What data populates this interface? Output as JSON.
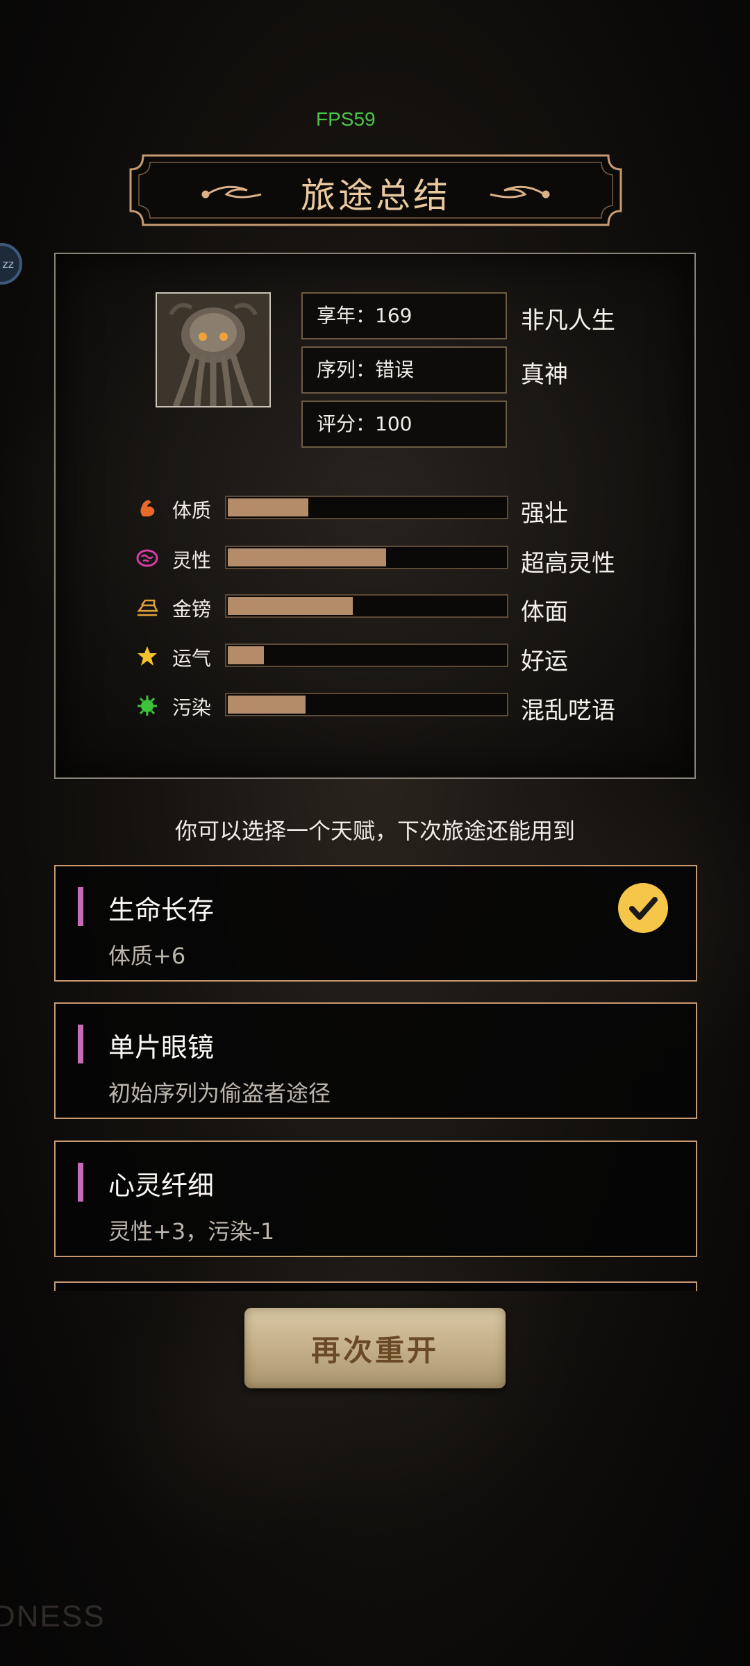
{
  "fps": "FPS59",
  "side_bubble": "zz",
  "banner": {
    "title": "旅途总结"
  },
  "summary": {
    "info": [
      {
        "label": "享年：169",
        "right": "非凡人生"
      },
      {
        "label": "序列：错误",
        "right": "真神"
      },
      {
        "label": "评分：100",
        "right": ""
      }
    ],
    "stats": [
      {
        "icon": "muscle-icon",
        "label": "体质",
        "fill": 0.29,
        "desc": "强壮",
        "color": "#e86a2a"
      },
      {
        "icon": "brain-icon",
        "label": "灵性",
        "fill": 0.57,
        "desc": "超高灵性",
        "color": "#d43ea0"
      },
      {
        "icon": "gold-bars-icon",
        "label": "金镑",
        "fill": 0.45,
        "desc": "体面",
        "color": "#e0a23a"
      },
      {
        "icon": "star-icon",
        "label": "运气",
        "fill": 0.13,
        "desc": "好运",
        "color": "#f5c22e"
      },
      {
        "icon": "virus-icon",
        "label": "污染",
        "fill": 0.28,
        "desc": "混乱呓语",
        "color": "#3ec43a"
      }
    ]
  },
  "prompt": "你可以选择一个天赋，下次旅途还能用到",
  "talents": [
    {
      "title": "生命长存",
      "desc": "体质+6",
      "selected": true
    },
    {
      "title": "单片眼镜",
      "desc": "初始序列为偷盗者途径",
      "selected": false
    },
    {
      "title": "心灵纤细",
      "desc": "灵性+3，污染-1",
      "selected": false
    }
  ],
  "restart_label": "再次重开",
  "watermark": "DNESS",
  "colors": {
    "accent": "#c79a70",
    "bar_fill": "#b48c6a",
    "talent_marker": "#c66bb8",
    "check": "#f6c64a"
  }
}
